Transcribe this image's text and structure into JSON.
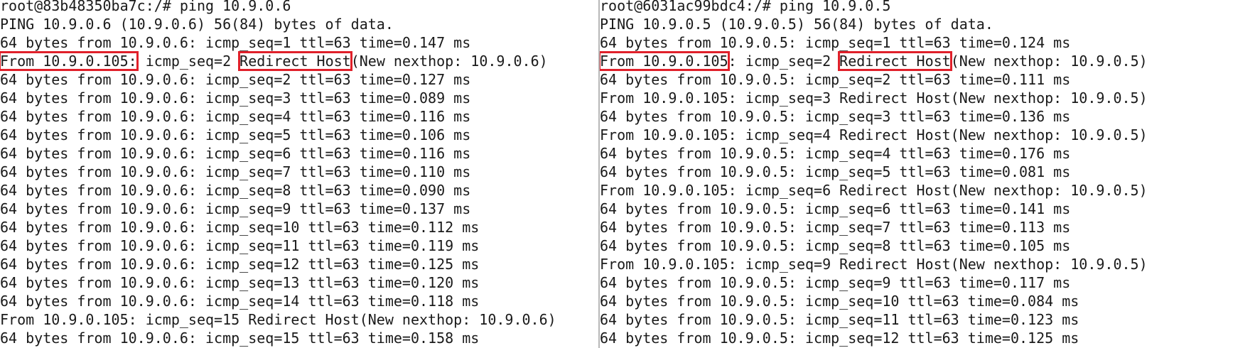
{
  "terminals": [
    {
      "id": "term-left",
      "lines": [
        [
          {
            "t": "root@83b48350ba7c:/# ping 10.9.0.6"
          }
        ],
        [
          {
            "t": "PING 10.9.0.6 (10.9.0.6) 56(84) bytes of data."
          }
        ],
        [
          {
            "t": "64 bytes from 10.9.0.6: icmp_seq=1 ttl=63 time=0.147 ms"
          }
        ],
        [
          {
            "t": "From 10.9.0.105:",
            "hl": true
          },
          {
            "t": " icmp_seq=2 "
          },
          {
            "t": "Redirect Host",
            "hl": true
          },
          {
            "t": "(New nexthop: 10.9.0.6)"
          }
        ],
        [
          {
            "t": "64 bytes from 10.9.0.6: icmp_seq=2 ttl=63 time=0.127 ms"
          }
        ],
        [
          {
            "t": "64 bytes from 10.9.0.6: icmp_seq=3 ttl=63 time=0.089 ms"
          }
        ],
        [
          {
            "t": "64 bytes from 10.9.0.6: icmp_seq=4 ttl=63 time=0.116 ms"
          }
        ],
        [
          {
            "t": "64 bytes from 10.9.0.6: icmp_seq=5 ttl=63 time=0.106 ms"
          }
        ],
        [
          {
            "t": "64 bytes from 10.9.0.6: icmp_seq=6 ttl=63 time=0.116 ms"
          }
        ],
        [
          {
            "t": "64 bytes from 10.9.0.6: icmp_seq=7 ttl=63 time=0.110 ms"
          }
        ],
        [
          {
            "t": "64 bytes from 10.9.0.6: icmp_seq=8 ttl=63 time=0.090 ms"
          }
        ],
        [
          {
            "t": "64 bytes from 10.9.0.6: icmp_seq=9 ttl=63 time=0.137 ms"
          }
        ],
        [
          {
            "t": "64 bytes from 10.9.0.6: icmp_seq=10 ttl=63 time=0.112 ms"
          }
        ],
        [
          {
            "t": "64 bytes from 10.9.0.6: icmp_seq=11 ttl=63 time=0.119 ms"
          }
        ],
        [
          {
            "t": "64 bytes from 10.9.0.6: icmp_seq=12 ttl=63 time=0.125 ms"
          }
        ],
        [
          {
            "t": "64 bytes from 10.9.0.6: icmp_seq=13 ttl=63 time=0.120 ms"
          }
        ],
        [
          {
            "t": "64 bytes from 10.9.0.6: icmp_seq=14 ttl=63 time=0.118 ms"
          }
        ],
        [
          {
            "t": "From 10.9.0.105: icmp_seq=15 Redirect Host(New nexthop: 10.9.0.6)"
          }
        ],
        [
          {
            "t": "64 bytes from 10.9.0.6: icmp_seq=15 ttl=63 time=0.158 ms"
          }
        ]
      ]
    },
    {
      "id": "term-right",
      "lines": [
        [
          {
            "t": "root@6031ac99bdc4:/# ping 10.9.0.5"
          }
        ],
        [
          {
            "t": "PING 10.9.0.5 (10.9.0.5) 56(84) bytes of data."
          }
        ],
        [
          {
            "t": "64 bytes from 10.9.0.5: icmp_seq=1 ttl=63 time=0.124 ms"
          }
        ],
        [
          {
            "t": "From 10.9.0.105",
            "hl": true
          },
          {
            "t": ": icmp_seq=2 "
          },
          {
            "t": "Redirect Host",
            "hl": true
          },
          {
            "t": "(New nexthop: 10.9.0.5)"
          }
        ],
        [
          {
            "t": "64 bytes from 10.9.0.5: icmp_seq=2 ttl=63 time=0.111 ms"
          }
        ],
        [
          {
            "t": "From 10.9.0.105: icmp_seq=3 Redirect Host(New nexthop: 10.9.0.5)"
          }
        ],
        [
          {
            "t": "64 bytes from 10.9.0.5: icmp_seq=3 ttl=63 time=0.136 ms"
          }
        ],
        [
          {
            "t": "From 10.9.0.105: icmp_seq=4 Redirect Host(New nexthop: 10.9.0.5)"
          }
        ],
        [
          {
            "t": "64 bytes from 10.9.0.5: icmp_seq=4 ttl=63 time=0.176 ms"
          }
        ],
        [
          {
            "t": "64 bytes from 10.9.0.5: icmp_seq=5 ttl=63 time=0.081 ms"
          }
        ],
        [
          {
            "t": "From 10.9.0.105: icmp_seq=6 Redirect Host(New nexthop: 10.9.0.5)"
          }
        ],
        [
          {
            "t": "64 bytes from 10.9.0.5: icmp_seq=6 ttl=63 time=0.141 ms"
          }
        ],
        [
          {
            "t": "64 bytes from 10.9.0.5: icmp_seq=7 ttl=63 time=0.113 ms"
          }
        ],
        [
          {
            "t": "64 bytes from 10.9.0.5: icmp_seq=8 ttl=63 time=0.105 ms"
          }
        ],
        [
          {
            "t": "From 10.9.0.105: icmp_seq=9 Redirect Host(New nexthop: 10.9.0.5)"
          }
        ],
        [
          {
            "t": "64 bytes from 10.9.0.5: icmp_seq=9 ttl=63 time=0.117 ms"
          }
        ],
        [
          {
            "t": "64 bytes from 10.9.0.5: icmp_seq=10 ttl=63 time=0.084 ms"
          }
        ],
        [
          {
            "t": "64 bytes from 10.9.0.5: icmp_seq=11 ttl=63 time=0.123 ms"
          }
        ],
        [
          {
            "t": "64 bytes from 10.9.0.5: icmp_seq=12 ttl=63 time=0.125 ms"
          }
        ]
      ]
    }
  ]
}
